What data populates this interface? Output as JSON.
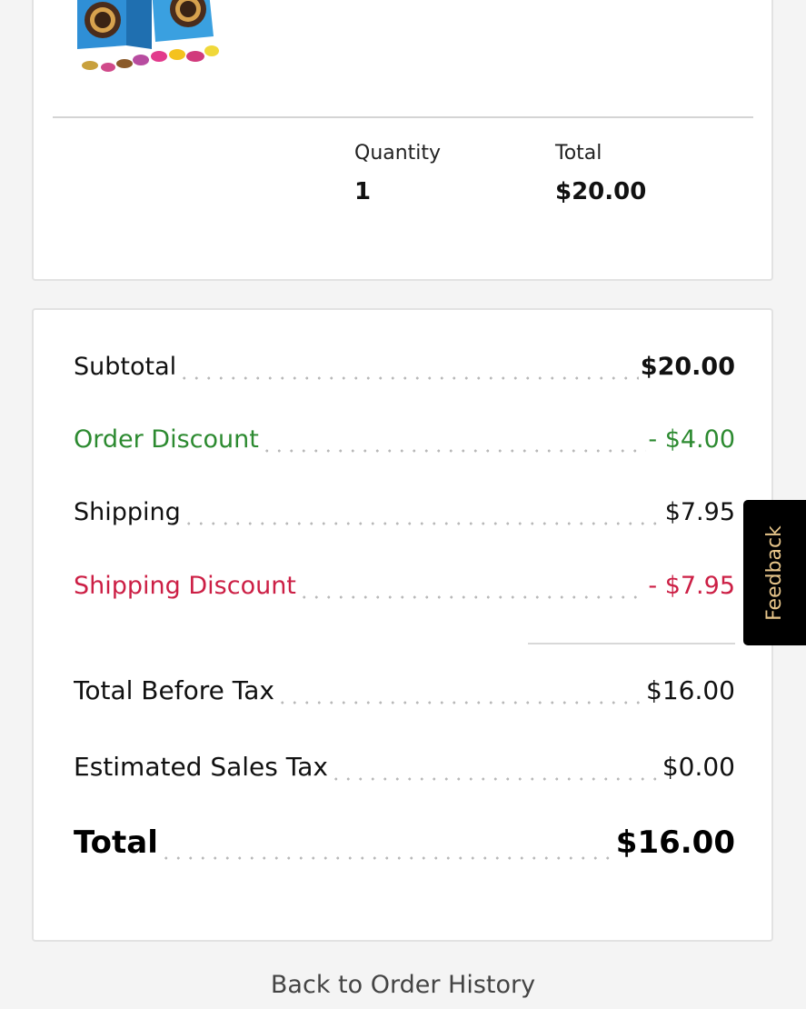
{
  "item": {
    "quantity_label": "Quantity",
    "quantity_value": "1",
    "total_label": "Total",
    "total_value": "$20.00"
  },
  "summary": {
    "subtotal_label": "Subtotal",
    "subtotal_value": "$20.00",
    "order_discount_label": "Order Discount",
    "order_discount_value": "- $4.00",
    "shipping_label": "Shipping",
    "shipping_value": "$7.95",
    "shipping_discount_label": "Shipping Discount",
    "shipping_discount_value": "- $7.95",
    "total_before_tax_label": "Total Before Tax",
    "total_before_tax_value": "$16.00",
    "sales_tax_label": "Estimated Sales Tax",
    "sales_tax_value": "$0.00",
    "total_label": "Total",
    "total_value": "$16.00"
  },
  "back_link_label": "Back to Order History",
  "feedback_label": "Feedback",
  "colors": {
    "discount_green": "#2c8a30",
    "discount_red": "#cc1f45",
    "feedback_bg": "#000000",
    "feedback_text": "#e7c58a"
  }
}
